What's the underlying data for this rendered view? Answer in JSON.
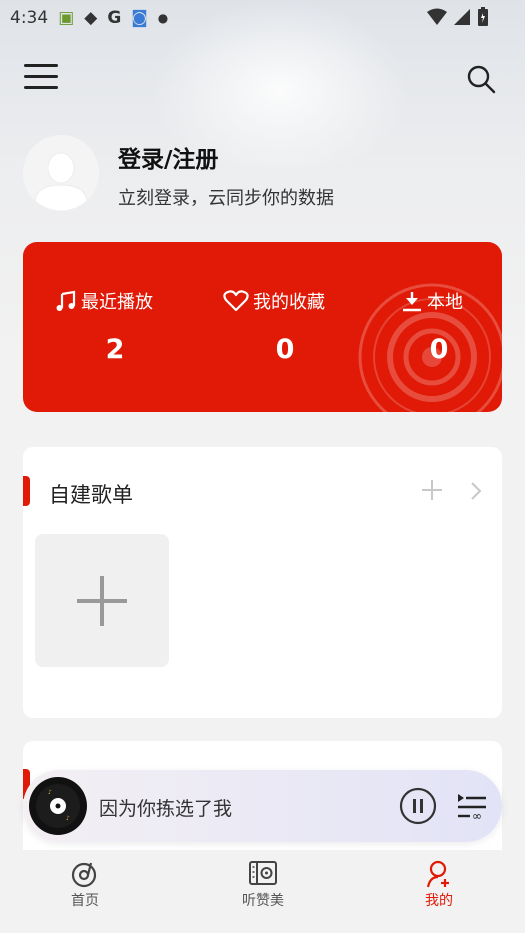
{
  "status_bar": {
    "time": "4:34",
    "icons": [
      "android-icon",
      "diamond-icon",
      "google-icon",
      "browser-icon",
      "dot-icon"
    ],
    "right_icons": [
      "wifi-icon",
      "signal-icon",
      "battery-icon"
    ]
  },
  "profile": {
    "title": "登录/注册",
    "subtitle": "立刻登录，云同步你的数据"
  },
  "stats": [
    {
      "label": "最近播放",
      "value": "2",
      "icon": "music-note-icon"
    },
    {
      "label": "我的收藏",
      "value": "0",
      "icon": "heart-icon"
    },
    {
      "label": "本地",
      "value": "0",
      "icon": "download-icon"
    }
  ],
  "playlist_section": {
    "title": "自建歌单"
  },
  "player": {
    "song": "因为你拣选了我"
  },
  "tabs": [
    {
      "label": "首页",
      "icon": "disc-note-icon",
      "active": false
    },
    {
      "label": "听赞美",
      "icon": "radio-icon",
      "active": false
    },
    {
      "label": "我的",
      "icon": "person-icon",
      "active": true
    }
  ],
  "colors": {
    "accent": "#e01a07",
    "background": "#f2f2f2"
  }
}
